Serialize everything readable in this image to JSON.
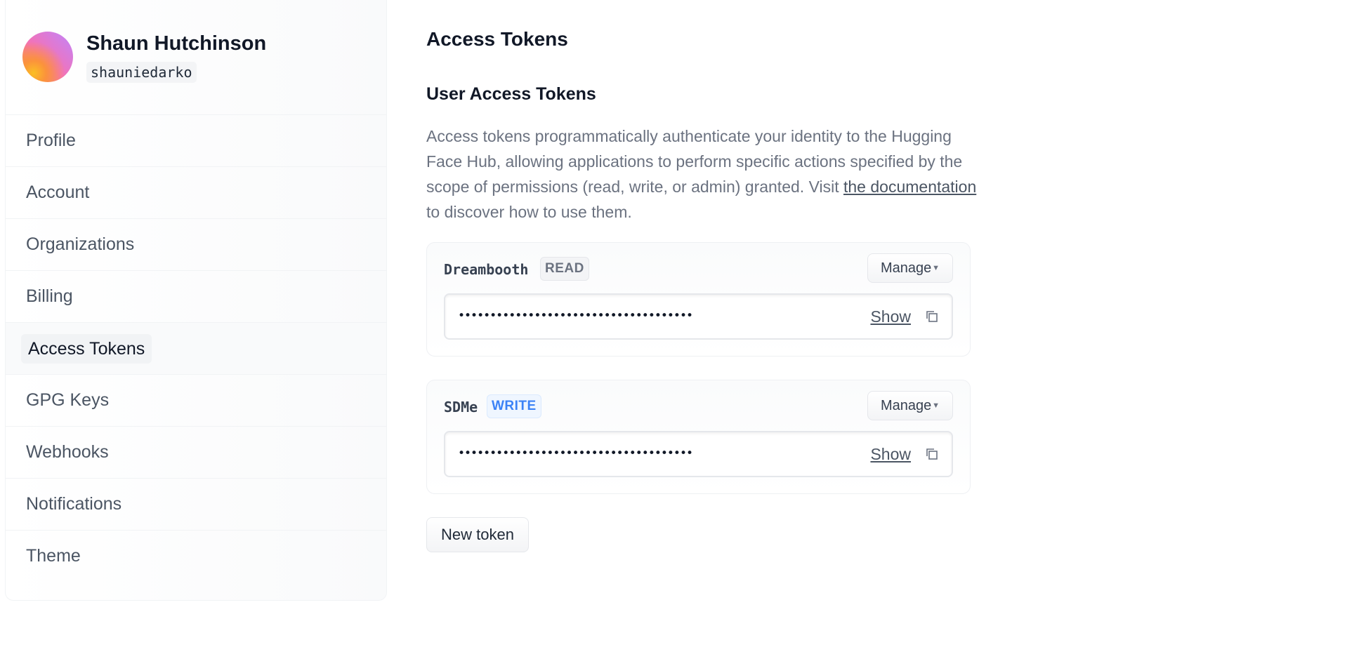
{
  "user": {
    "name": "Shaun Hutchinson",
    "handle": "shauniedarko"
  },
  "sidebar": {
    "items": [
      {
        "label": "Profile"
      },
      {
        "label": "Account"
      },
      {
        "label": "Organizations"
      },
      {
        "label": "Billing"
      },
      {
        "label": "Access Tokens",
        "active": true
      },
      {
        "label": "GPG Keys"
      },
      {
        "label": "Webhooks"
      },
      {
        "label": "Notifications"
      },
      {
        "label": "Theme"
      }
    ]
  },
  "main": {
    "title": "Access Tokens",
    "section_title": "User Access Tokens",
    "description_before": "Access tokens programmatically authenticate your identity to the Hugging Face Hub, allowing applications to perform specific actions specified by the scope of permissions (read, write, or admin) granted. Visit ",
    "description_link": "the documentation",
    "description_after": " to discover how to use them.",
    "tokens": [
      {
        "name": "Dreambooth",
        "role": "READ",
        "masked_value": "•••••••••••••••••••••••••••••••••••••",
        "show_label": "Show",
        "manage_label": "Manage"
      },
      {
        "name": "SDMe",
        "role": "WRITE",
        "masked_value": "•••••••••••••••••••••••••••••••••••••",
        "show_label": "Show",
        "manage_label": "Manage"
      }
    ],
    "new_token_label": "New token"
  },
  "icons": {
    "copy": "copy-icon",
    "caret": "caret-down-icon"
  },
  "colors": {
    "write_badge": "#3b82f6",
    "read_badge": "#6b7280"
  }
}
